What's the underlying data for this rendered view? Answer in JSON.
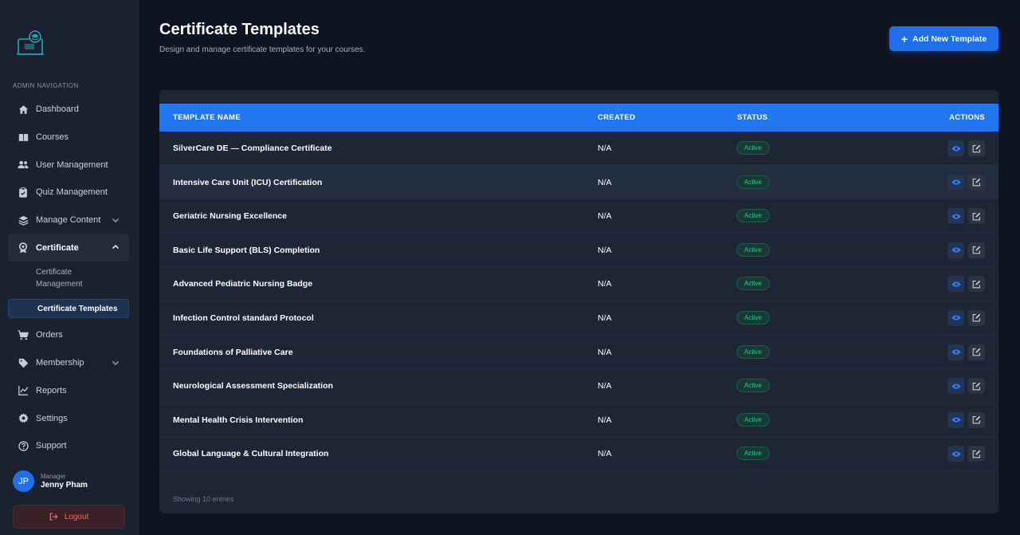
{
  "sidebar": {
    "heading": "ADMIN NAVIGATION",
    "items": [
      {
        "label": "Dashboard",
        "icon": "home-icon"
      },
      {
        "label": "Courses",
        "icon": "book-icon"
      },
      {
        "label": "User Management",
        "icon": "users-icon"
      },
      {
        "label": "Quiz Management",
        "icon": "clipboard-icon"
      },
      {
        "label": "Manage Content",
        "icon": "layers-icon"
      },
      {
        "label": "Certificate",
        "icon": "award-icon"
      },
      {
        "label": "Orders",
        "icon": "cart-icon"
      },
      {
        "label": "Membership",
        "icon": "tag-icon"
      },
      {
        "label": "Reports",
        "icon": "chart-icon"
      },
      {
        "label": "Settings",
        "icon": "gear-icon"
      },
      {
        "label": "Support",
        "icon": "question-icon"
      }
    ],
    "certificate_sub": [
      "Certificate Management",
      "Certificate Templates"
    ],
    "user": {
      "initials": "JP",
      "role": "Manager",
      "name": "Jenny Pham"
    },
    "logout_label": "Logout"
  },
  "header": {
    "title": "Certificate Templates",
    "subtitle": "Design and manage certificate templates for your courses.",
    "add_button_label": "Add New Template"
  },
  "table": {
    "columns": [
      "TEMPLATE NAME",
      "CREATED",
      "STATUS",
      "ACTIONS"
    ],
    "rows": [
      {
        "name": "SilverCare DE — Compliance Certificate",
        "created": "N/A",
        "status": "Active"
      },
      {
        "name": "Intensive Care Unit (ICU) Certification",
        "created": "N/A",
        "status": "Active"
      },
      {
        "name": "Geriatric Nursing Excellence",
        "created": "N/A",
        "status": "Active"
      },
      {
        "name": "Basic Life Support (BLS) Completion",
        "created": "N/A",
        "status": "Active"
      },
      {
        "name": "Advanced Pediatric Nursing Badge",
        "created": "N/A",
        "status": "Active"
      },
      {
        "name": "Infection Control standard Protocol",
        "created": "N/A",
        "status": "Active"
      },
      {
        "name": "Foundations of Palliative Care",
        "created": "N/A",
        "status": "Active"
      },
      {
        "name": "Neurological Assessment Specialization",
        "created": "N/A",
        "status": "Active"
      },
      {
        "name": "Mental Health Crisis Intervention",
        "created": "N/A",
        "status": "Active"
      },
      {
        "name": "Global Language & Cultural Integration",
        "created": "N/A",
        "status": "Active"
      }
    ],
    "footer": "Showing 10 entries"
  },
  "colors": {
    "accent": "#2376f2",
    "active_badge": "#35c88e",
    "logout": "#f06a6a"
  }
}
